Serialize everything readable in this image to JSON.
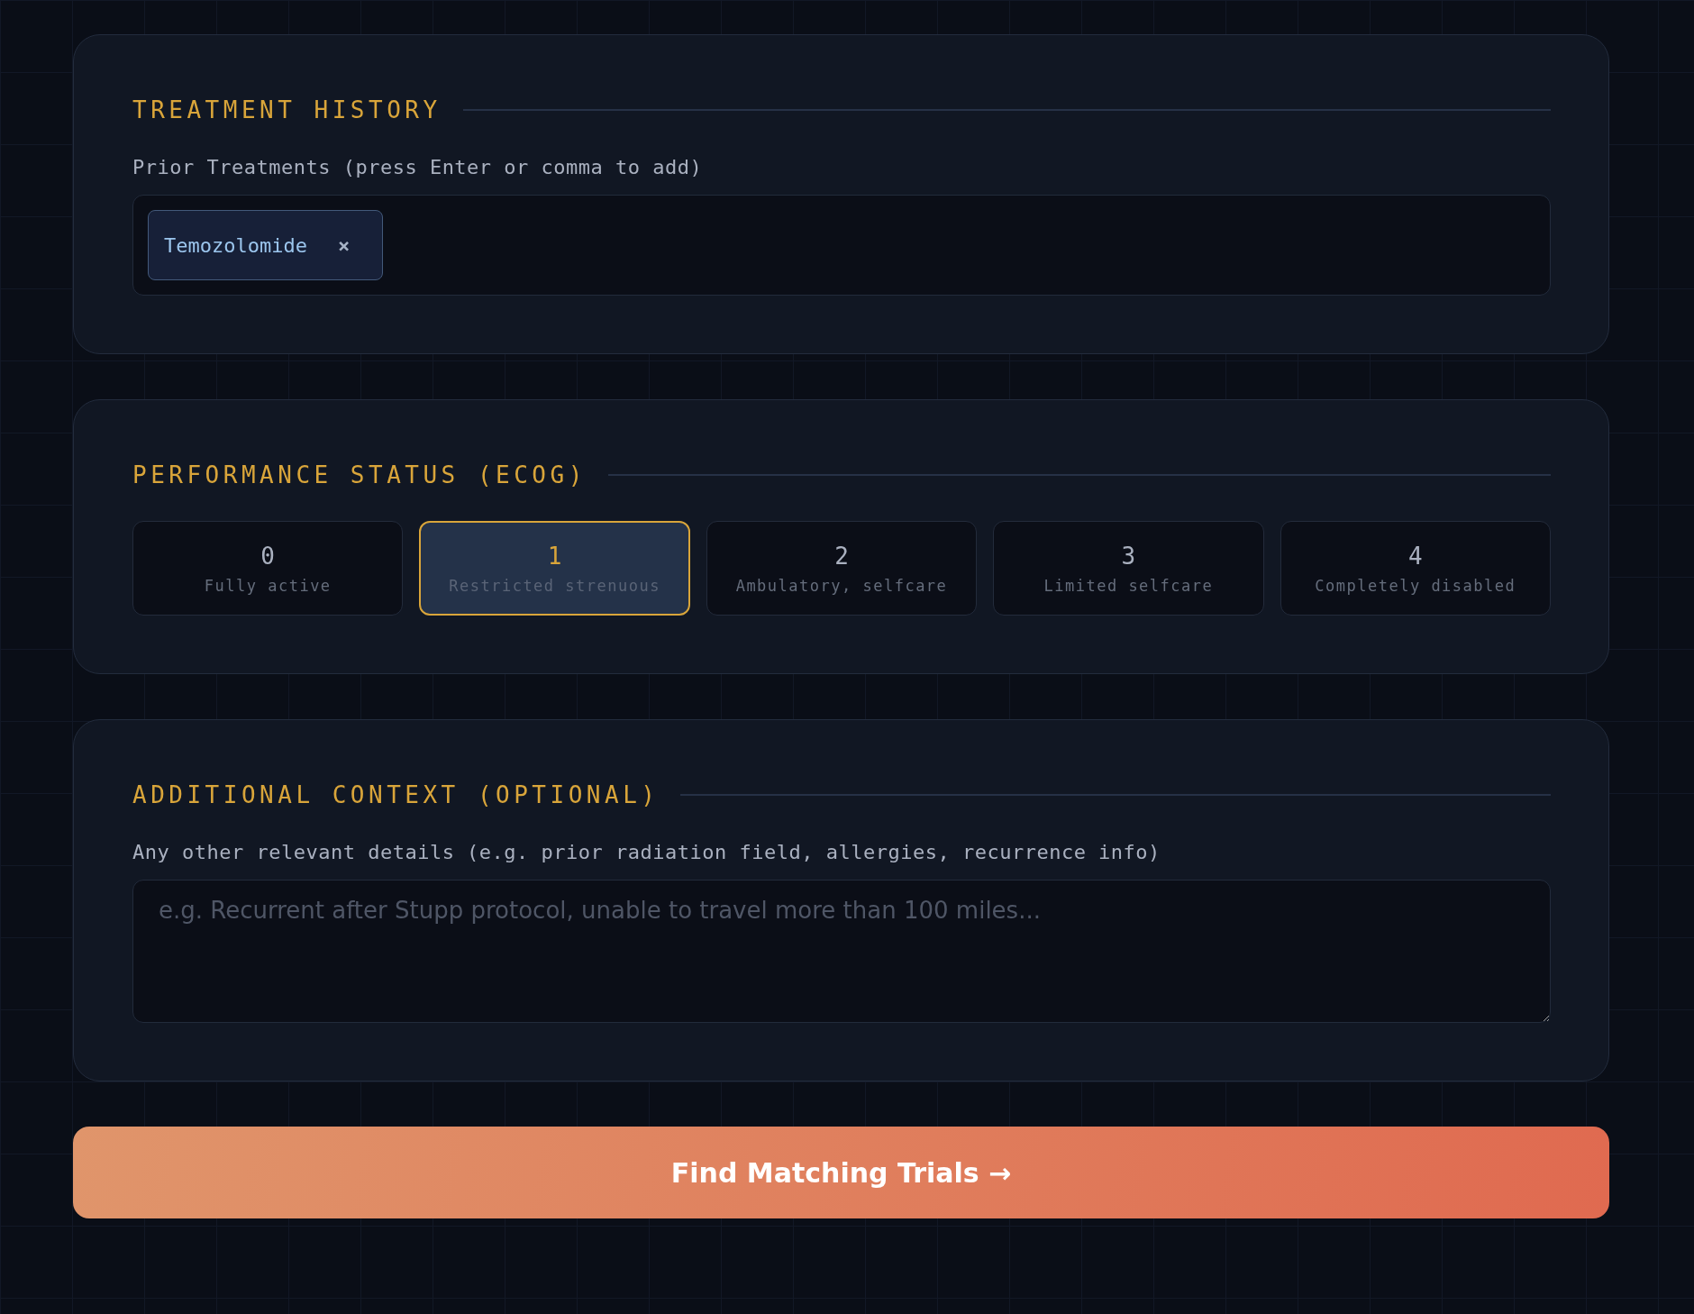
{
  "treatment_history": {
    "title": "TREATMENT HISTORY",
    "label": "Prior Treatments (press Enter or comma to add)",
    "tags": [
      {
        "text": "Temozolomide",
        "remove": "×"
      }
    ]
  },
  "performance_status": {
    "title": "PERFORMANCE STATUS (ECOG)",
    "options": [
      {
        "value": "0",
        "description": "Fully active",
        "selected": false
      },
      {
        "value": "1",
        "description": "Restricted strenuous",
        "selected": true
      },
      {
        "value": "2",
        "description": "Ambulatory, selfcare",
        "selected": false
      },
      {
        "value": "3",
        "description": "Limited selfcare",
        "selected": false
      },
      {
        "value": "4",
        "description": "Completely disabled",
        "selected": false
      }
    ]
  },
  "additional_context": {
    "title": "ADDITIONAL CONTEXT (OPTIONAL)",
    "label": "Any other relevant details (e.g. prior radiation field, allergies, recurrence info)",
    "placeholder": "e.g. Recurrent after Stupp protocol, unable to travel more than 100 miles..."
  },
  "submit_button": "Find Matching Trials →"
}
